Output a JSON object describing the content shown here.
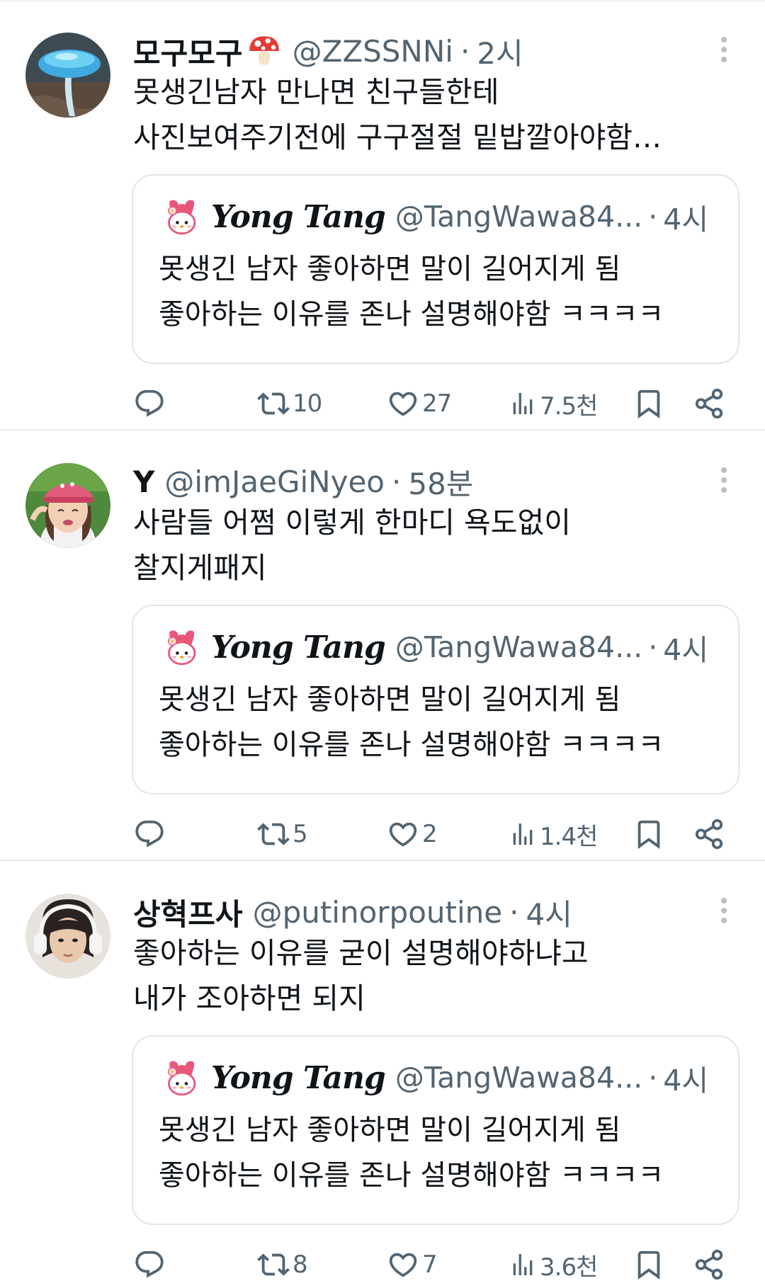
{
  "tweets": [
    {
      "display_name": "모구모구",
      "name_emoji_icon": "mushroom-icon",
      "handle": "@ZZSSNNi",
      "dot": "·",
      "time": "2시",
      "avatar_icon": "blue-mushroom-avatar",
      "text_line1": "못생긴남자 만나면 친구들한테",
      "text_line2": "사진보여주기전에 구구절절 밑밥깔아야함…",
      "quote": {
        "name": "Yong Tang",
        "handle": "@TangWawa84...",
        "dot": "·",
        "time": "4시",
        "text_line1": "못생긴 남자 좋아하면 말이 길어지게 됨",
        "text_line2": "좋아하는 이유를 존나 설명해야함 ㅋㅋㅋㅋ"
      },
      "actions": {
        "replies": "",
        "retweets": "10",
        "likes": "27",
        "views": "7.5천"
      }
    },
    {
      "display_name": "Y",
      "handle": "@imJaeGiNyeo",
      "dot": "·",
      "time": "58분",
      "avatar_icon": "girl-pink-cap-avatar",
      "text_line1": "사람들 어쩜 이렇게 한마디 욕도없이",
      "text_line2": "찰지게패지",
      "quote": {
        "name": "Yong Tang",
        "handle": "@TangWawa84...",
        "dot": "·",
        "time": "4시",
        "text_line1": "못생긴 남자 좋아하면 말이 길어지게 됨",
        "text_line2": "좋아하는 이유를 존나 설명해야함 ㅋㅋㅋㅋ"
      },
      "actions": {
        "replies": "",
        "retweets": "5",
        "likes": "2",
        "views": "1.4천"
      }
    },
    {
      "display_name": "상혁프사",
      "handle": "@putinorpoutine",
      "dot": "·",
      "time": "4시",
      "avatar_icon": "headphones-person-avatar",
      "text_line1": "좋아하는 이유를 굳이 설명해야하냐고",
      "text_line2": "내가 조아하면 되지",
      "quote": {
        "name": "Yong Tang",
        "handle": "@TangWawa84...",
        "dot": "·",
        "time": "4시",
        "text_line1": "못생긴 남자 좋아하면 말이 길어지게 됨",
        "text_line2": "좋아하는 이유를 존나 설명해야함 ㅋㅋㅋㅋ"
      },
      "actions": {
        "replies": "",
        "retweets": "8",
        "likes": "7",
        "views": "3.6천"
      }
    }
  ],
  "colors": {
    "text_primary": "#0f1419",
    "text_secondary": "#536471",
    "border": "#e1e6e9"
  }
}
